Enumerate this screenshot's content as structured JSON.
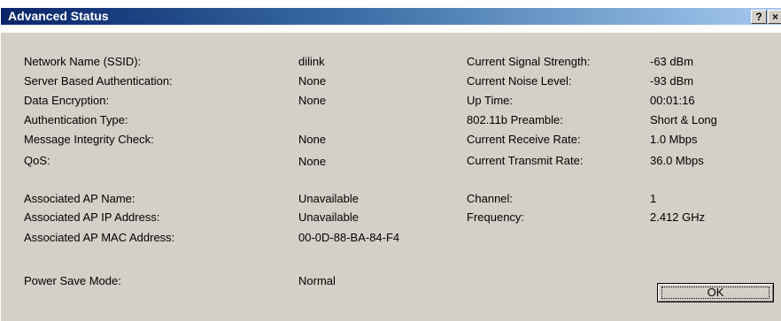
{
  "window": {
    "title": "Advanced Status",
    "help_label": "?",
    "close_label": "×"
  },
  "left_fields": [
    {
      "label": "Network Name (SSID):",
      "value": "dilink"
    },
    {
      "label": "Server Based Authentication:",
      "value": "None"
    },
    {
      "label": "Data Encryption:",
      "value": "None"
    },
    {
      "label": "Authentication Type:",
      "value": ""
    },
    {
      "label": "Message Integrity Check:",
      "value": "None"
    },
    {
      "label": "QoS:",
      "value": "None"
    },
    {
      "label": "Associated AP Name:",
      "value": "Unavailable"
    },
    {
      "label": "Associated AP IP Address:",
      "value": "Unavailable"
    },
    {
      "label": "Associated AP MAC Address:",
      "value": "00-0D-88-BA-84-F4"
    },
    {
      "label": "Power Save Mode:",
      "value": "Normal"
    }
  ],
  "right_fields": [
    {
      "label": "Current Signal Strength:",
      "value": "-63 dBm"
    },
    {
      "label": "Current Noise Level:",
      "value": "-93 dBm"
    },
    {
      "label": "Up Time:",
      "value": "00:01:16"
    },
    {
      "label": "802.11b Preamble:",
      "value": "Short & Long"
    },
    {
      "label": "Current Receive Rate:",
      "value": "1.0 Mbps"
    },
    {
      "label": "Current Transmit Rate:",
      "value": "36.0 Mbps"
    },
    {
      "label": "Channel:",
      "value": "1"
    },
    {
      "label": "Frequency:",
      "value": "2.412 GHz"
    }
  ],
  "ok_label": "OK"
}
